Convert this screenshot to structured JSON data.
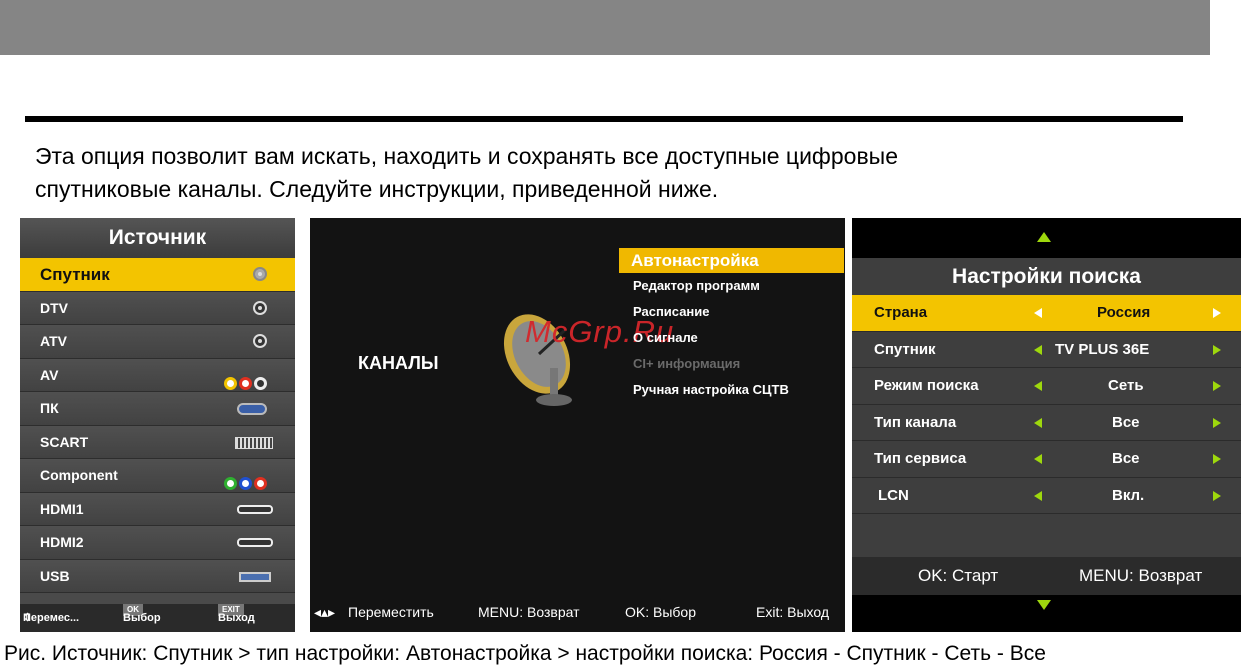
{
  "intro": {
    "line1": "Эта опция позволит вам искать, находить и сохранять все доступные цифровые",
    "line2": "спутниковые каналы. Следуйте инструкции, приведенной ниже."
  },
  "source_menu": {
    "title": "Источник",
    "items": [
      {
        "label": "Спутник",
        "icon": "round-connector-icon"
      },
      {
        "label": "DTV",
        "icon": "round-connector-icon"
      },
      {
        "label": "ATV",
        "icon": "round-connector-icon"
      },
      {
        "label": "AV",
        "icon": "rca-connectors-icon"
      },
      {
        "label": "ПК",
        "icon": "vga-connector-icon"
      },
      {
        "label": "SCART",
        "icon": "scart-connector-icon"
      },
      {
        "label": "Component",
        "icon": "component-connectors-icon"
      },
      {
        "label": "HDMI1",
        "icon": "hdmi-connector-icon"
      },
      {
        "label": "HDMI2",
        "icon": "hdmi-connector-icon"
      },
      {
        "label": "USB",
        "icon": "usb-connector-icon"
      }
    ],
    "footer": {
      "move": "Перемес...",
      "ok_key": "OK",
      "select": "Выбор",
      "exit_key": "EXIT",
      "exit": "Выход"
    }
  },
  "channels_menu": {
    "label": "КАНАЛЫ",
    "items": [
      "Автонастройка",
      "Редактор программ",
      "Расписание",
      "О сигнале",
      "CI+ информация",
      "Ручная настройка СЦТВ"
    ],
    "footer": {
      "move": "Переместить",
      "back": "MENU: Возврат",
      "select": "OK: Выбор",
      "exit": "Exit: Выход"
    }
  },
  "watermark": "McGrp.Ru",
  "search_settings": {
    "title": "Настройки поиска",
    "rows": [
      {
        "label": "Страна",
        "value": "Россия"
      },
      {
        "label": "Спутник",
        "value": "TV PLUS 36E"
      },
      {
        "label": "Режим поиска",
        "value": "Сеть"
      },
      {
        "label": "Тип канала",
        "value": "Все"
      },
      {
        "label": "Тип сервиса",
        "value": "Все"
      },
      {
        "label": "LCN",
        "value": "Вкл."
      }
    ],
    "footer": {
      "start": "OK: Старт",
      "back": "MENU: Возврат"
    }
  },
  "caption": "Рис. Источник: Спутник > тип настройки: Автонастройка > настройки поиска:  Россия - Спутник - Сеть - Все",
  "colors": {
    "highlight": "#f3c400",
    "arrow": "#9ed80d"
  }
}
